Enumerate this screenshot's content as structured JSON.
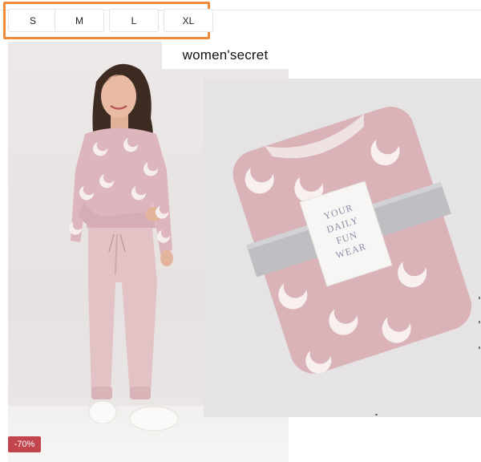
{
  "size_selector": {
    "sizes": [
      "S",
      "M",
      "L",
      "XL"
    ]
  },
  "product": {
    "brand": "women'secret",
    "discount_badge": "-70%",
    "package_label": [
      "YOUR",
      "DAILY",
      "FUN",
      "WEAR"
    ]
  },
  "colors": {
    "highlight_border": "#f08a3a",
    "discount_badge_bg": "#c2454d",
    "pajama_pink": "#dcb6bc"
  },
  "images": {
    "model_photo": "model-wearing-pink-moon-pajamas",
    "folded_product_photo": "folded-pink-moon-fleece-pajama"
  }
}
